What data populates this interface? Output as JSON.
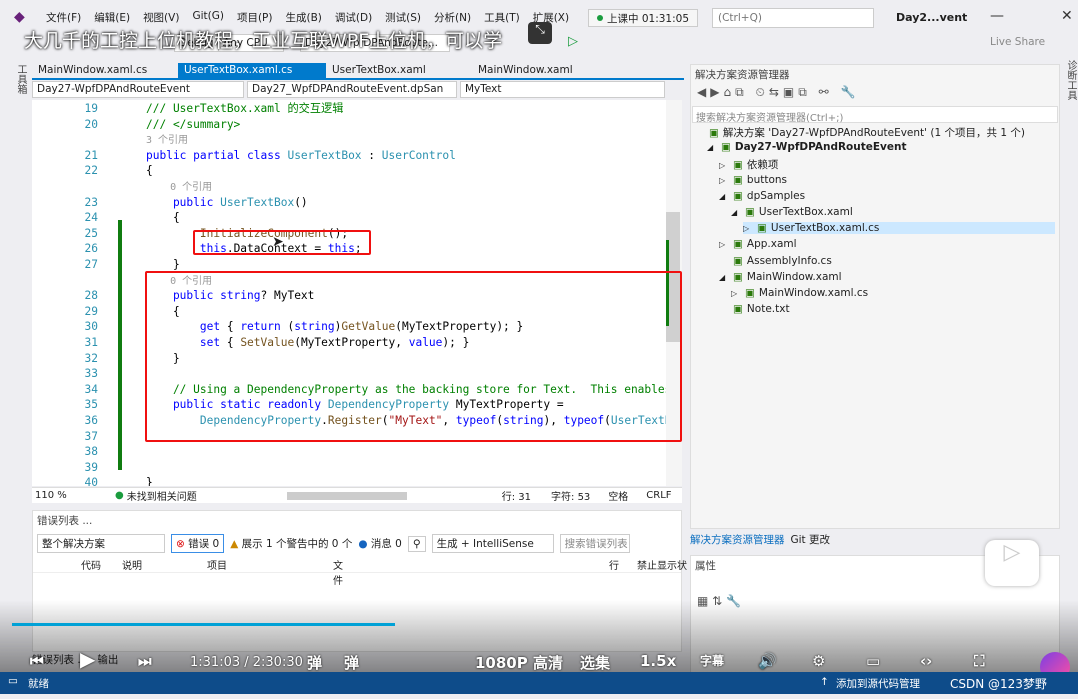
{
  "menu": [
    "文件(F)",
    "编辑(E)",
    "视图(V)",
    "Git(G)",
    "项目(P)",
    "生成(B)",
    "调试(D)",
    "测试(S)",
    "分析(N)",
    "工具(T)",
    "扩展(X)"
  ],
  "live_status": "上课中 01:31:05",
  "search_placeholder": "(Ctrl+Q)",
  "window_title": "Day2...vent",
  "overlay_title": "大几千的工控上位机教程，工业互联WPF上位机，可以学",
  "toolbar": {
    "config": "Debug",
    "platform": "Any CPU",
    "startup": "Day27-WpfDPAndRoute...",
    "live_share": "Live Share"
  },
  "left_strip": "工具箱",
  "right_strip": "诊断工具",
  "tabs": [
    {
      "label": "MainWindow.xaml.cs",
      "active": false
    },
    {
      "label": "UserTextBox.xaml.cs",
      "active": true
    },
    {
      "label": "UserTextBox.xaml",
      "active": false
    },
    {
      "label": "MainWindow.xaml",
      "active": false
    }
  ],
  "nav": {
    "project": "Day27-WpfDPAndRouteEvent",
    "class": "Day27_WpfDPAndRouteEvent.dpSan",
    "member": "MyText"
  },
  "code": [
    {
      "n": "19",
      "t": [
        [
          "/// UserTextBox.xaml 的交互逻辑",
          "cm"
        ]
      ]
    },
    {
      "n": "20",
      "t": [
        [
          "/// </summary>",
          "cm"
        ]
      ]
    },
    {
      "n": "",
      "t": [
        [
          "3 个引用",
          "lens"
        ]
      ]
    },
    {
      "n": "21",
      "t": [
        [
          "public partial class ",
          "kw"
        ],
        [
          "UserTextBox",
          "ty"
        ],
        [
          " : ",
          "pl"
        ],
        [
          "UserControl",
          "ty"
        ]
      ]
    },
    {
      "n": "22",
      "t": [
        [
          "{",
          "pl"
        ]
      ]
    },
    {
      "n": "",
      "t": [
        [
          "    0 个引用",
          "lens"
        ]
      ]
    },
    {
      "n": "23",
      "t": [
        [
          "    public ",
          "kw"
        ],
        [
          "UserTextBox",
          "ty"
        ],
        [
          "()",
          "pl"
        ]
      ]
    },
    {
      "n": "24",
      "t": [
        [
          "    {",
          "pl"
        ]
      ]
    },
    {
      "n": "25",
      "t": [
        [
          "        ",
          "pl"
        ],
        [
          "InitializeComponent",
          "me"
        ],
        [
          "();",
          "pl"
        ]
      ]
    },
    {
      "n": "26",
      "t": [
        [
          "        this",
          "kw"
        ],
        [
          ".DataContext = ",
          "pl"
        ],
        [
          "this",
          "kw"
        ],
        [
          ";",
          "pl"
        ]
      ]
    },
    {
      "n": "27",
      "t": [
        [
          "    }",
          "pl"
        ]
      ]
    },
    {
      "n": "",
      "t": [
        [
          "    0 个引用",
          "lens"
        ]
      ]
    },
    {
      "n": "28",
      "t": [
        [
          "    public string",
          "kw"
        ],
        [
          "? MyText",
          "pl"
        ]
      ]
    },
    {
      "n": "29",
      "t": [
        [
          "    {",
          "pl"
        ]
      ]
    },
    {
      "n": "30",
      "t": [
        [
          "        get",
          "kw"
        ],
        [
          " { ",
          "pl"
        ],
        [
          "return",
          "kw"
        ],
        [
          " (",
          "pl"
        ],
        [
          "string",
          "kw"
        ],
        [
          ")",
          "pl"
        ],
        [
          "GetValue",
          "me"
        ],
        [
          "(MyTextProperty); }",
          "pl"
        ]
      ]
    },
    {
      "n": "31",
      "t": [
        [
          "        set",
          "kw"
        ],
        [
          " { ",
          "pl"
        ],
        [
          "SetValue",
          "me"
        ],
        [
          "(MyTextProperty, ",
          "pl"
        ],
        [
          "value",
          "kw"
        ],
        [
          "); }",
          "pl"
        ]
      ]
    },
    {
      "n": "32",
      "t": [
        [
          "    }",
          "pl"
        ]
      ]
    },
    {
      "n": "33",
      "t": [
        [
          "",
          "pl"
        ]
      ]
    },
    {
      "n": "34",
      "t": [
        [
          "    // Using a DependencyProperty as the backing store for Text.  This enables",
          "cm"
        ]
      ]
    },
    {
      "n": "35",
      "t": [
        [
          "    public static readonly ",
          "kw"
        ],
        [
          "DependencyProperty",
          "ty"
        ],
        [
          " MyTextProperty =",
          "pl"
        ]
      ]
    },
    {
      "n": "36",
      "t": [
        [
          "        ",
          "pl"
        ],
        [
          "DependencyProperty",
          "ty"
        ],
        [
          ".",
          "pl"
        ],
        [
          "Register",
          "me"
        ],
        [
          "(",
          "pl"
        ],
        [
          "\"MyText\"",
          "st"
        ],
        [
          ", ",
          "pl"
        ],
        [
          "typeof",
          "kw"
        ],
        [
          "(",
          "pl"
        ],
        [
          "string",
          "kw"
        ],
        [
          "), ",
          "pl"
        ],
        [
          "typeof",
          "kw"
        ],
        [
          "(",
          "pl"
        ],
        [
          "UserTextB",
          "ty"
        ]
      ]
    },
    {
      "n": "37",
      "t": []
    },
    {
      "n": "38",
      "t": []
    },
    {
      "n": "39",
      "t": []
    },
    {
      "n": "40",
      "t": [
        [
          "}",
          "pl"
        ]
      ]
    }
  ],
  "editor_status": {
    "zoom": "110 %",
    "issues": "未找到相关问题",
    "line": "行: 31",
    "col": "字符: 53",
    "spaces": "空格",
    "eol": "CRLF"
  },
  "error_list": {
    "title": "错误列表 ...",
    "scope": "整个解决方案",
    "errors": "错误 0",
    "warnings": "展示 1 个警告中的 0 个",
    "messages": "消息 0",
    "source": "生成 + IntelliSense",
    "search_placeholder": "搜索错误列表",
    "columns": [
      "代码",
      "说明",
      "项目",
      "文件",
      "行",
      "禁止显示状"
    ]
  },
  "bottom_tabs": [
    "错误列表 ...",
    "输出"
  ],
  "solution": {
    "title": "解决方案资源管理器",
    "search_placeholder": "搜索解决方案资源管理器(Ctrl+;)",
    "items": [
      {
        "label": "解决方案 'Day27-WpfDPAndRouteEvent' (1 个项目，共 1 个)",
        "depth": 0,
        "arrow": "",
        "bold": false
      },
      {
        "label": "Day27-WpfDPAndRouteEvent",
        "depth": 1,
        "arrow": "◢",
        "bold": true
      },
      {
        "label": "依赖项",
        "depth": 2,
        "arrow": "▷",
        "bold": false
      },
      {
        "label": "buttons",
        "depth": 2,
        "arrow": "▷",
        "bold": false
      },
      {
        "label": "dpSamples",
        "depth": 2,
        "arrow": "◢",
        "bold": false
      },
      {
        "label": "UserTextBox.xaml",
        "depth": 3,
        "arrow": "◢",
        "bold": false
      },
      {
        "label": "UserTextBox.xaml.cs",
        "depth": 4,
        "arrow": "▷",
        "bold": false,
        "selected": true
      },
      {
        "label": "App.xaml",
        "depth": 2,
        "arrow": "▷",
        "bold": false
      },
      {
        "label": "AssemblyInfo.cs",
        "depth": 2,
        "arrow": "",
        "bold": false
      },
      {
        "label": "MainWindow.xaml",
        "depth": 2,
        "arrow": "◢",
        "bold": false
      },
      {
        "label": "MainWindow.xaml.cs",
        "depth": 3,
        "arrow": "▷",
        "bold": false
      },
      {
        "label": "Note.txt",
        "depth": 2,
        "arrow": "",
        "bold": false
      }
    ],
    "tabs": [
      "解决方案资源管理器",
      "Git 更改"
    ]
  },
  "properties": {
    "title": "属性"
  },
  "statusbar": {
    "ready": "就绪",
    "source_control": "添加到源代码管理",
    "watermark": "CSDN @123梦野"
  },
  "video": {
    "time": "1:31:03 / 2:30:30",
    "quality": "1080P 高清",
    "episodes": "选集",
    "speed": "1.5x",
    "progress": 0.6,
    "subtitle": "字幕"
  }
}
